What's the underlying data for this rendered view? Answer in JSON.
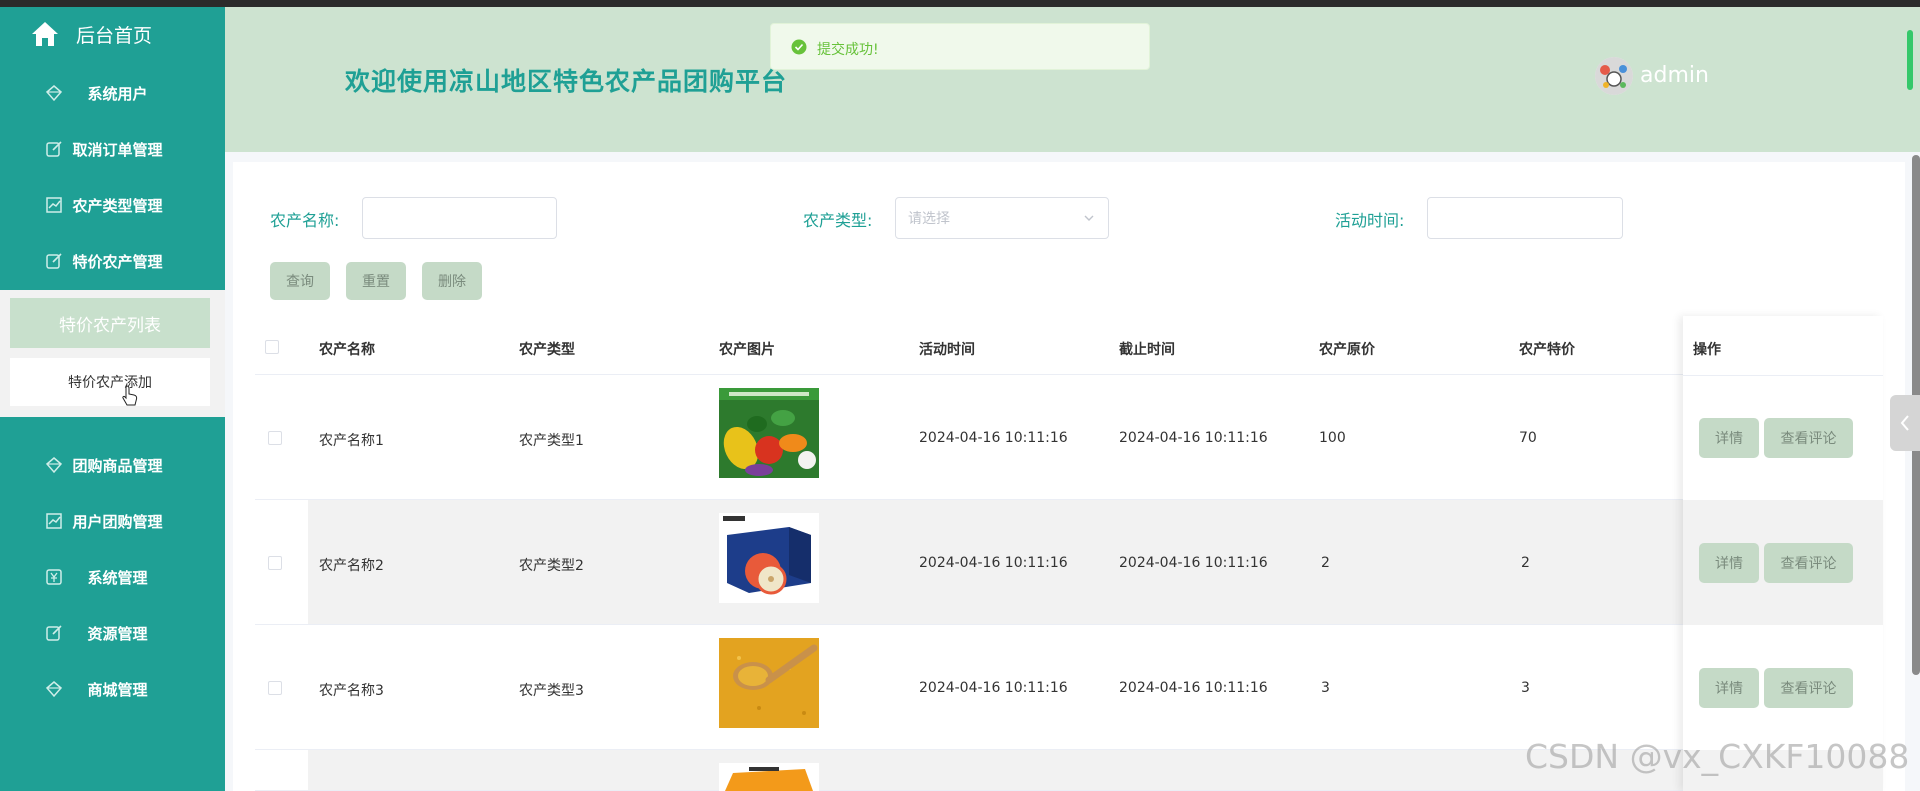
{
  "sidebar": {
    "home_label": "后台首页",
    "items": [
      {
        "label": "系统用户",
        "icon": "diamond-icon"
      },
      {
        "label": "取消订单管理",
        "icon": "edit-icon"
      },
      {
        "label": "农产类型管理",
        "icon": "chart-icon"
      },
      {
        "label": "特价农产管理",
        "icon": "edit-icon"
      },
      {
        "label": "团购商品管理",
        "icon": "diamond-icon"
      },
      {
        "label": "用户团购管理",
        "icon": "chart-icon"
      },
      {
        "label": "系统管理",
        "icon": "yen-icon"
      },
      {
        "label": "资源管理",
        "icon": "edit-icon"
      },
      {
        "label": "商城管理",
        "icon": "diamond-icon"
      }
    ],
    "submenu": {
      "active": "特价农产列表",
      "add": "特价农产添加"
    }
  },
  "header": {
    "welcome": "欢迎使用凉山地区特色农产品团购平台",
    "username": "admin"
  },
  "toast": {
    "message": "提交成功!"
  },
  "filters": {
    "name_label": "农产名称:",
    "type_label": "农产类型:",
    "type_placeholder": "请选择",
    "time_label": "活动时间:"
  },
  "buttons": {
    "search": "查询",
    "reset": "重置",
    "delete": "删除"
  },
  "table": {
    "headers": [
      "农产名称",
      "农产类型",
      "农产图片",
      "活动时间",
      "截止时间",
      "农产原价",
      "农产特价",
      "操作"
    ],
    "rows": [
      {
        "name": "农产名称1",
        "type": "农产类型1",
        "image": "vegetables-image",
        "start": "2024-04-16 10:11:16",
        "end": "2024-04-16 10:11:16",
        "price": "100",
        "special": "70"
      },
      {
        "name": "农产名称2",
        "type": "农产类型2",
        "image": "apple-box-image",
        "start": "2024-04-16 10:11:16",
        "end": "2024-04-16 10:11:16",
        "price": "2",
        "special": "2"
      },
      {
        "name": "农产名称3",
        "type": "农产类型3",
        "image": "millet-image",
        "start": "2024-04-16 10:11:16",
        "end": "2024-04-16 10:11:16",
        "price": "3",
        "special": "3"
      }
    ],
    "ops": {
      "detail": "详情",
      "comments": "查看评论"
    }
  },
  "watermark": "CSDN @vx_CXKF10088",
  "colors": {
    "sidebar": "#1fa095",
    "header": "#cde3d0",
    "button": "#c5dac7",
    "success": "#67c23a"
  }
}
